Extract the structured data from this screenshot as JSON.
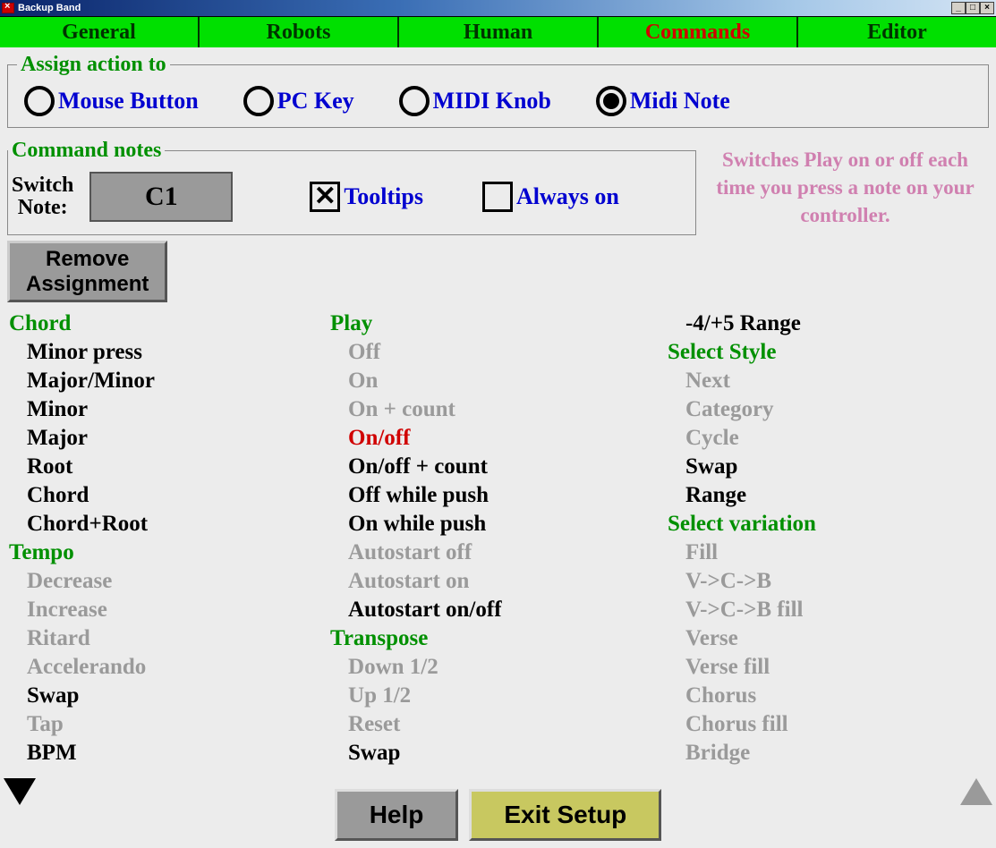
{
  "window": {
    "title": "Backup Band"
  },
  "tabs": [
    "General",
    "Robots",
    "Human",
    "Commands",
    "Editor"
  ],
  "active_tab": "Commands",
  "assign": {
    "legend": "Assign action to",
    "options": [
      "Mouse Button",
      "PC Key",
      "MIDI Knob",
      "Midi Note"
    ],
    "selected": "Midi Note"
  },
  "notes": {
    "legend": "Command notes",
    "switch_label_1": "Switch",
    "switch_label_2": "Note:",
    "note_value": "C1",
    "tooltips_label": "Tooltips",
    "tooltips_checked": true,
    "always_label": "Always on",
    "always_checked": false
  },
  "hint": "Switches Play on or off each time you press a note on your controller.",
  "remove_label_1": "Remove",
  "remove_label_2": "Assignment",
  "col1": {
    "chord": {
      "header": "Chord",
      "items": [
        "Minor press",
        "Major/Minor",
        "Minor",
        "Major",
        "Root",
        "Chord",
        "Chord+Root"
      ]
    },
    "tempo": {
      "header": "Tempo",
      "items": [
        {
          "t": "Decrease",
          "dim": true
        },
        {
          "t": "Increase",
          "dim": true
        },
        {
          "t": "Ritard",
          "dim": true
        },
        {
          "t": "Accelerando",
          "dim": true
        },
        {
          "t": "Swap",
          "dim": false
        },
        {
          "t": "Tap",
          "dim": true
        },
        {
          "t": "BPM",
          "dim": false
        }
      ]
    }
  },
  "col2": {
    "play": {
      "header": "Play",
      "items": [
        {
          "t": "Off",
          "dim": true
        },
        {
          "t": "On",
          "dim": true
        },
        {
          "t": "On + count",
          "dim": true
        },
        {
          "t": "On/off",
          "sel": true
        },
        {
          "t": "On/off + count"
        },
        {
          "t": "Off while push"
        },
        {
          "t": "On while push"
        },
        {
          "t": "Autostart off",
          "dim": true
        },
        {
          "t": "Autostart on",
          "dim": true
        },
        {
          "t": "Autostart on/off"
        }
      ]
    },
    "transpose": {
      "header": "Transpose",
      "items": [
        {
          "t": "Down 1/2",
          "dim": true
        },
        {
          "t": "Up 1/2",
          "dim": true
        },
        {
          "t": "Reset",
          "dim": true
        },
        {
          "t": "Swap"
        }
      ]
    }
  },
  "col3": {
    "top_item": "-4/+5 Range",
    "select_style": {
      "header": "Select Style",
      "items": [
        {
          "t": "Next",
          "dim": true
        },
        {
          "t": "Category",
          "dim": true
        },
        {
          "t": "Cycle",
          "dim": true
        },
        {
          "t": "Swap"
        },
        {
          "t": "Range"
        }
      ]
    },
    "select_var": {
      "header": "Select variation",
      "items": [
        {
          "t": "Fill",
          "dim": true
        },
        {
          "t": "V->C->B",
          "dim": true
        },
        {
          "t": "V->C->B fill",
          "dim": true
        },
        {
          "t": "Verse",
          "dim": true
        },
        {
          "t": "Verse fill",
          "dim": true
        },
        {
          "t": "Chorus",
          "dim": true
        },
        {
          "t": "Chorus fill",
          "dim": true
        },
        {
          "t": "Bridge",
          "dim": true
        }
      ]
    }
  },
  "footer": {
    "help": "Help",
    "exit": "Exit Setup"
  }
}
